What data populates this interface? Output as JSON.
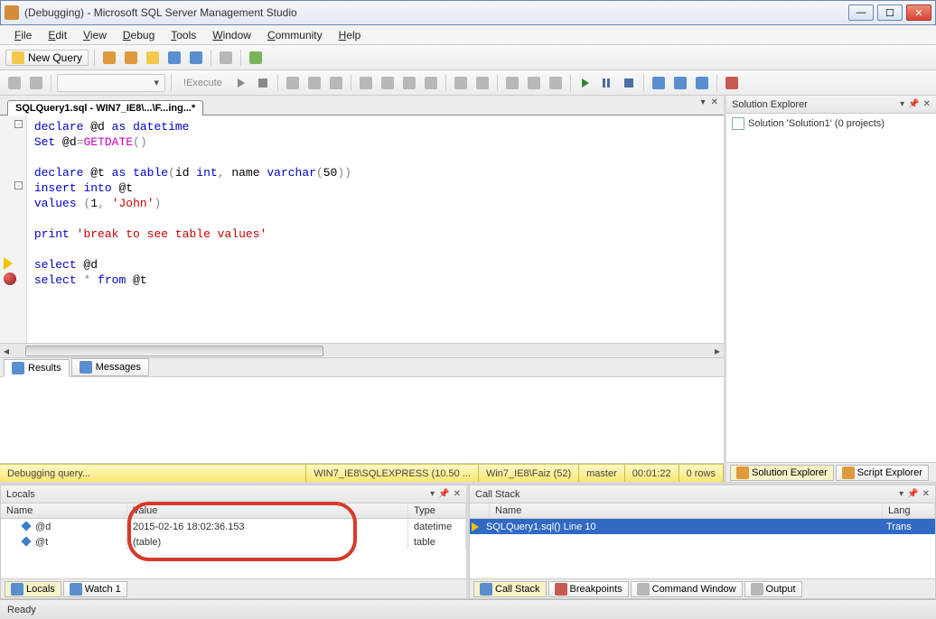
{
  "titlebar": {
    "text": "(Debugging) - Microsoft SQL Server Management Studio"
  },
  "menu": {
    "file": "File",
    "edit": "Edit",
    "view": "View",
    "debug": "Debug",
    "tools": "Tools",
    "window": "Window",
    "community": "Community",
    "help": "Help"
  },
  "toolbar": {
    "new_query": "New Query",
    "execute": "Execute"
  },
  "editor": {
    "tab_title": "SQLQuery1.sql - WIN7_IE8\\...\\F...ing...*",
    "code_lines": [
      {
        "t": "declare @d as datetime",
        "cls": [
          "kw",
          "var",
          "kw",
          "kw"
        ]
      },
      {
        "t": "Set @d=GETDATE()"
      },
      {
        "t": ""
      },
      {
        "t": "declare @t as table(id int, name varchar(50))"
      },
      {
        "t": "insert into @t"
      },
      {
        "t": "values (1, 'John')"
      },
      {
        "t": ""
      },
      {
        "t": "print 'break to see table values'"
      },
      {
        "t": ""
      },
      {
        "t": "select @d"
      },
      {
        "t": "select * from @t"
      }
    ]
  },
  "results_tabs": {
    "results": "Results",
    "messages": "Messages"
  },
  "status_strip": {
    "state": "Debugging query...",
    "server": "WIN7_IE8\\SQLEXPRESS (10.50 ...",
    "user": "Win7_IE8\\Faiz (52)",
    "db": "master",
    "elapsed": "00:01:22",
    "rows": "0 rows"
  },
  "solution_explorer": {
    "title": "Solution Explorer",
    "item": "Solution 'Solution1' (0 projects)",
    "tab_solution": "Solution Explorer",
    "tab_script": "Script Explorer"
  },
  "locals": {
    "title": "Locals",
    "col_name": "Name",
    "col_value": "Value",
    "col_type": "Type",
    "rows": [
      {
        "name": "@d",
        "value": "2015-02-16 18:02:36.153",
        "type": "datetime"
      },
      {
        "name": "@t",
        "value": "(table)",
        "type": "table"
      }
    ],
    "tab_locals": "Locals",
    "tab_watch": "Watch 1"
  },
  "callstack": {
    "title": "Call Stack",
    "col_name": "Name",
    "col_lang": "Lang",
    "row_name": "SQLQuery1.sql() Line 10",
    "row_lang": "Trans",
    "tab_callstack": "Call Stack",
    "tab_breakpoints": "Breakpoints",
    "tab_command": "Command Window",
    "tab_output": "Output"
  },
  "statusbar": {
    "text": "Ready"
  }
}
